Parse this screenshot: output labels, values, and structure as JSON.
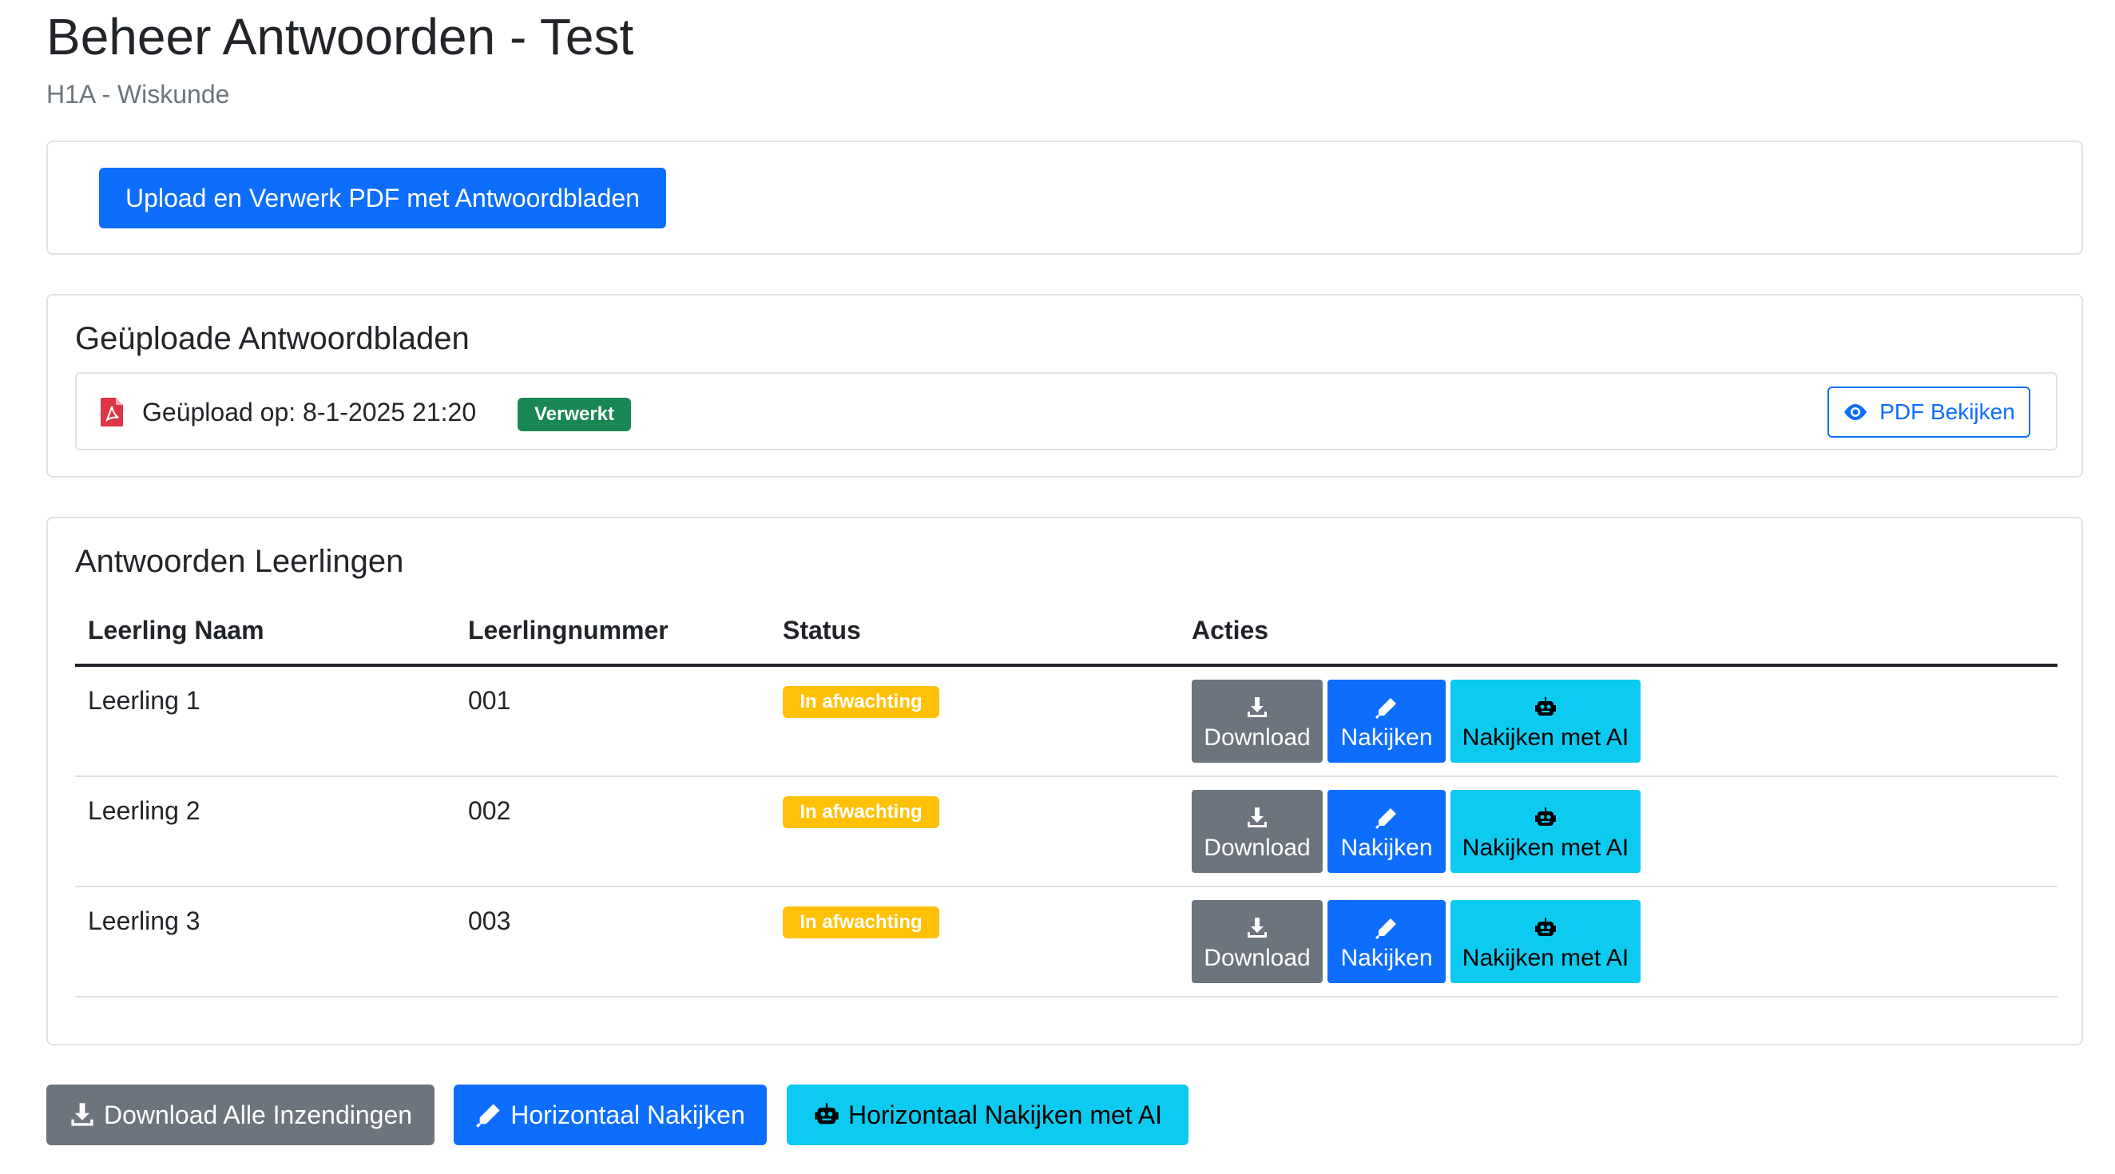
{
  "header": {
    "title": "Beheer Antwoorden - Test",
    "subtitle": "H1A - Wiskunde"
  },
  "upload": {
    "button_label": "Upload en Verwerk PDF met Antwoordbladen"
  },
  "uploaded": {
    "title": "Geüploade Antwoordbladen",
    "item_text": "Geüpload op: 8-1-2025 21:20",
    "status_badge": "Verwerkt",
    "view_button": "PDF Bekijken"
  },
  "answers": {
    "title": "Antwoorden Leerlingen",
    "columns": [
      "Leerling Naam",
      "Leerlingnummer",
      "Status",
      "Acties"
    ],
    "rows": [
      {
        "name": "Leerling 1",
        "number": "001",
        "status": "In afwachting"
      },
      {
        "name": "Leerling 2",
        "number": "002",
        "status": "In afwachting"
      },
      {
        "name": "Leerling 3",
        "number": "003",
        "status": "In afwachting"
      }
    ],
    "action_labels": {
      "download": "Download",
      "grade": "Nakijken",
      "grade_ai": "Nakijken met AI"
    }
  },
  "footer": {
    "download_all": "Download Alle Inzendingen",
    "horizontal": "Horizontaal Nakijken",
    "horizontal_ai": "Horizontaal Nakijken met AI"
  },
  "colors": {
    "primary": "#0d6efd",
    "secondary": "#6c757d",
    "info": "#0dcaf0",
    "success": "#198754",
    "warning": "#ffc107",
    "pdf_icon": "#dc3545"
  },
  "icons": {
    "pdf": "file-pdf-icon",
    "view": "eye-icon",
    "download": "download-icon",
    "grade": "pen-icon",
    "ai": "robot-icon"
  }
}
